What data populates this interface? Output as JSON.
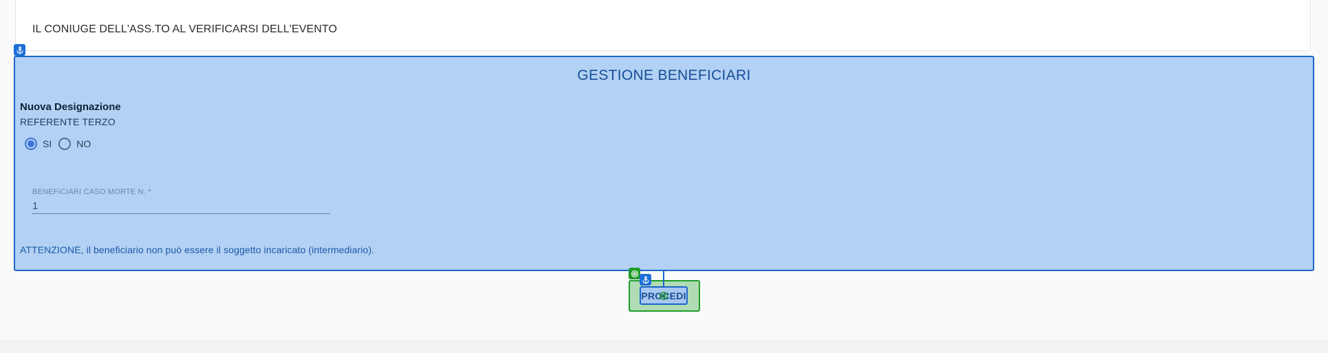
{
  "top_card": {
    "text": "IL CONIUGE DELL'ASS.TO AL VERIFICARSI DELL'EVENTO"
  },
  "section": {
    "title": "GESTIONE BENEFICIARI",
    "subtitle": "Nuova Designazione",
    "referente_label": "REFERENTE TERZO",
    "radio_options": [
      {
        "label": "SI",
        "checked": true
      },
      {
        "label": "NO",
        "checked": false
      }
    ],
    "beneficiari_field": {
      "label": "BENEFICIARI CASO MORTE N. *",
      "value": "1"
    },
    "warning": "ATTENZIONE, il beneficiario non può essere il soggetto incaricato (intermediario)."
  },
  "proceed_button": {
    "label": "PROCEDI"
  },
  "colors": {
    "section_bg": "#b3d1f4",
    "section_border": "#1a66cc",
    "highlight_green": "#1f9c2c",
    "radio_accent": "#3d74d8"
  },
  "icons": {
    "section_badge": "anchor-icon",
    "button_badge": "anchor-icon",
    "green_badge": "target-icon"
  }
}
